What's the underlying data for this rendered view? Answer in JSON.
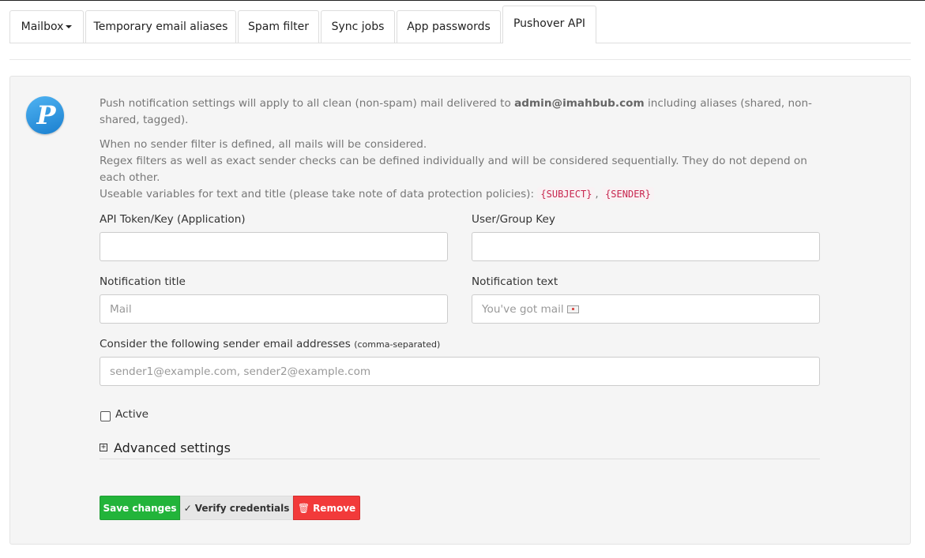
{
  "tabs": [
    {
      "label": "Mailbox"
    },
    {
      "label": "Temporary email aliases"
    },
    {
      "label": "Spam filter"
    },
    {
      "label": "Sync jobs"
    },
    {
      "label": "App passwords"
    },
    {
      "label": "Pushover API",
      "active": true
    }
  ],
  "logo": {
    "letter": "P",
    "color": "#2a8fe0"
  },
  "info": {
    "line1_pre": "Push notification settings will apply to all clean (non-spam) mail delivered to ",
    "line1_email": "admin@imahbub.com",
    "line1_post": " including aliases (shared, non-shared, tagged).",
    "line2": "When no sender filter is defined, all mails will be considered.",
    "line3": "Regex filters as well as exact sender checks can be defined individually and will be considered sequentially. They do not depend on each other.",
    "line4_pre": "Useable variables for text and title (please take note of data protection policies): ",
    "var_subject": "{SUBJECT}",
    "var_sep": ",",
    "var_sender": "{SENDER}"
  },
  "form": {
    "api_token_label": "API Token/Key (Application)",
    "api_token_value": "",
    "user_key_label": "User/Group Key",
    "user_key_value": "",
    "title_label": "Notification title",
    "title_placeholder": "Mail",
    "text_label": "Notification text",
    "text_placeholder": "You've got mail",
    "senders_label": "Consider the following sender email addresses",
    "senders_hint": "(comma-separated)",
    "senders_placeholder": "sender1@example.com, sender2@example.com",
    "active_label": "Active",
    "active_checked": false,
    "advanced_label": "Advanced settings"
  },
  "buttons": {
    "save": "Save changes",
    "verify": "Verify credentials",
    "remove": "Remove"
  },
  "colors": {
    "save": "#22b43a",
    "remove": "#f23a3a",
    "verify": "#e6e6e6",
    "code": "#c7254e"
  }
}
